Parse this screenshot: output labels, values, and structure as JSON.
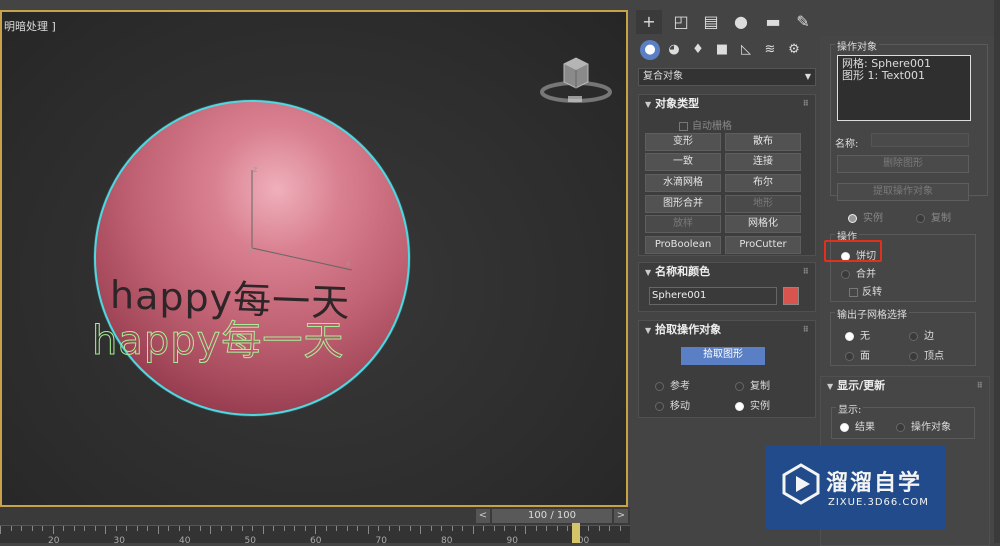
{
  "viewport": {
    "label": "明暗处理 ]",
    "scene_text": "happy每一天"
  },
  "timeslider": {
    "frame": "100 / 100",
    "prev": "<",
    "next": ">",
    "ticks": [
      "20",
      "30",
      "40",
      "50",
      "60",
      "70",
      "80",
      "90",
      "100"
    ]
  },
  "command_panel": {
    "tabs": [
      "create",
      "modify",
      "hierarchy",
      "motion",
      "display",
      "utilities"
    ],
    "subtabs": [
      "geometry",
      "shapes",
      "lights",
      "cameras",
      "helpers",
      "space-warps",
      "systems"
    ],
    "category": "复合对象",
    "object_type": {
      "title": "对象类型",
      "autogrid": "自动栅格",
      "buttons": [
        {
          "label": "变形",
          "enabled": true
        },
        {
          "label": "散布",
          "enabled": true
        },
        {
          "label": "一致",
          "enabled": true
        },
        {
          "label": "连接",
          "enabled": true
        },
        {
          "label": "水滴网格",
          "enabled": true
        },
        {
          "label": "布尔",
          "enabled": true
        },
        {
          "label": "图形合并",
          "enabled": true
        },
        {
          "label": "地形",
          "enabled": false
        },
        {
          "label": "放样",
          "enabled": false
        },
        {
          "label": "网格化",
          "enabled": true
        },
        {
          "label": "ProBoolean",
          "enabled": true
        },
        {
          "label": "ProCutter",
          "enabled": true
        }
      ]
    },
    "name_color": {
      "title": "名称和颜色",
      "name": "Sphere001",
      "color": "#d9534f"
    },
    "pick_operand": {
      "title": "拾取操作对象",
      "button": "拾取图形",
      "options": [
        {
          "label": "参考",
          "on": false
        },
        {
          "label": "复制",
          "on": false
        },
        {
          "label": "移动",
          "on": false
        },
        {
          "label": "实例",
          "on": true
        }
      ]
    }
  },
  "modifier_panel": {
    "operands_title": "操作对象",
    "operands": [
      "网格: Sphere001",
      "图形 1: Text001"
    ],
    "name_label": "名称:",
    "name_value": "",
    "delete_shape": "删除图形",
    "extract_operand": "提取操作对象",
    "instance": "实例",
    "copy": "复制",
    "operations_title": "操作",
    "operations": [
      {
        "label": "饼切",
        "on": true
      },
      {
        "label": "合并",
        "on": false
      }
    ],
    "invert": "反转",
    "output_title": "输出子网格选择",
    "output": [
      {
        "label": "无",
        "on": true
      },
      {
        "label": "边",
        "on": false
      },
      {
        "label": "面",
        "on": false
      },
      {
        "label": "顶点",
        "on": false
      }
    ],
    "display_update_title": "显示/更新",
    "display_label": "显示:",
    "display_options": [
      {
        "label": "结果",
        "on": true
      },
      {
        "label": "操作对象",
        "on": false
      }
    ]
  },
  "watermark": {
    "brand": "溜溜自学",
    "url": "ZIXUE.3D66.COM"
  }
}
